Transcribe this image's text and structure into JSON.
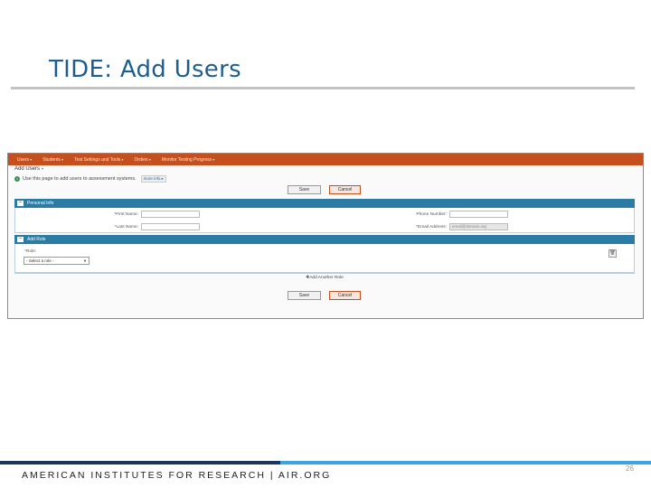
{
  "slide": {
    "title": "TIDE: Add Users",
    "page_number": "26"
  },
  "footer": {
    "text": "AMERICAN INSTITUTES FOR RESEARCH | AIR.ORG"
  },
  "nav": {
    "items": [
      "Users",
      "Students",
      "Test Settings and Tools",
      "Orders",
      "Monitor Testing Progress"
    ]
  },
  "page": {
    "heading": "Add Users",
    "info_text": "Use this page to add users to assessment systems.",
    "more_info": "more info"
  },
  "buttons": {
    "save": "Save",
    "cancel": "Cancel"
  },
  "personal_info": {
    "label": "Personal Info",
    "first_name_label": "*First Name:",
    "last_name_label": "*Last Name:",
    "phone_label": "Phone Number:",
    "email_label": "*Email Address:",
    "email_placeholder": "email@domain.org"
  },
  "add_role": {
    "label": "Add Role",
    "role_label": "*Role:",
    "role_selected": "- Select a role -",
    "add_another": "Add Another Role"
  },
  "colors": {
    "nav": "#c5501d",
    "section": "#2b7ca5",
    "title": "#1f5e8c"
  }
}
